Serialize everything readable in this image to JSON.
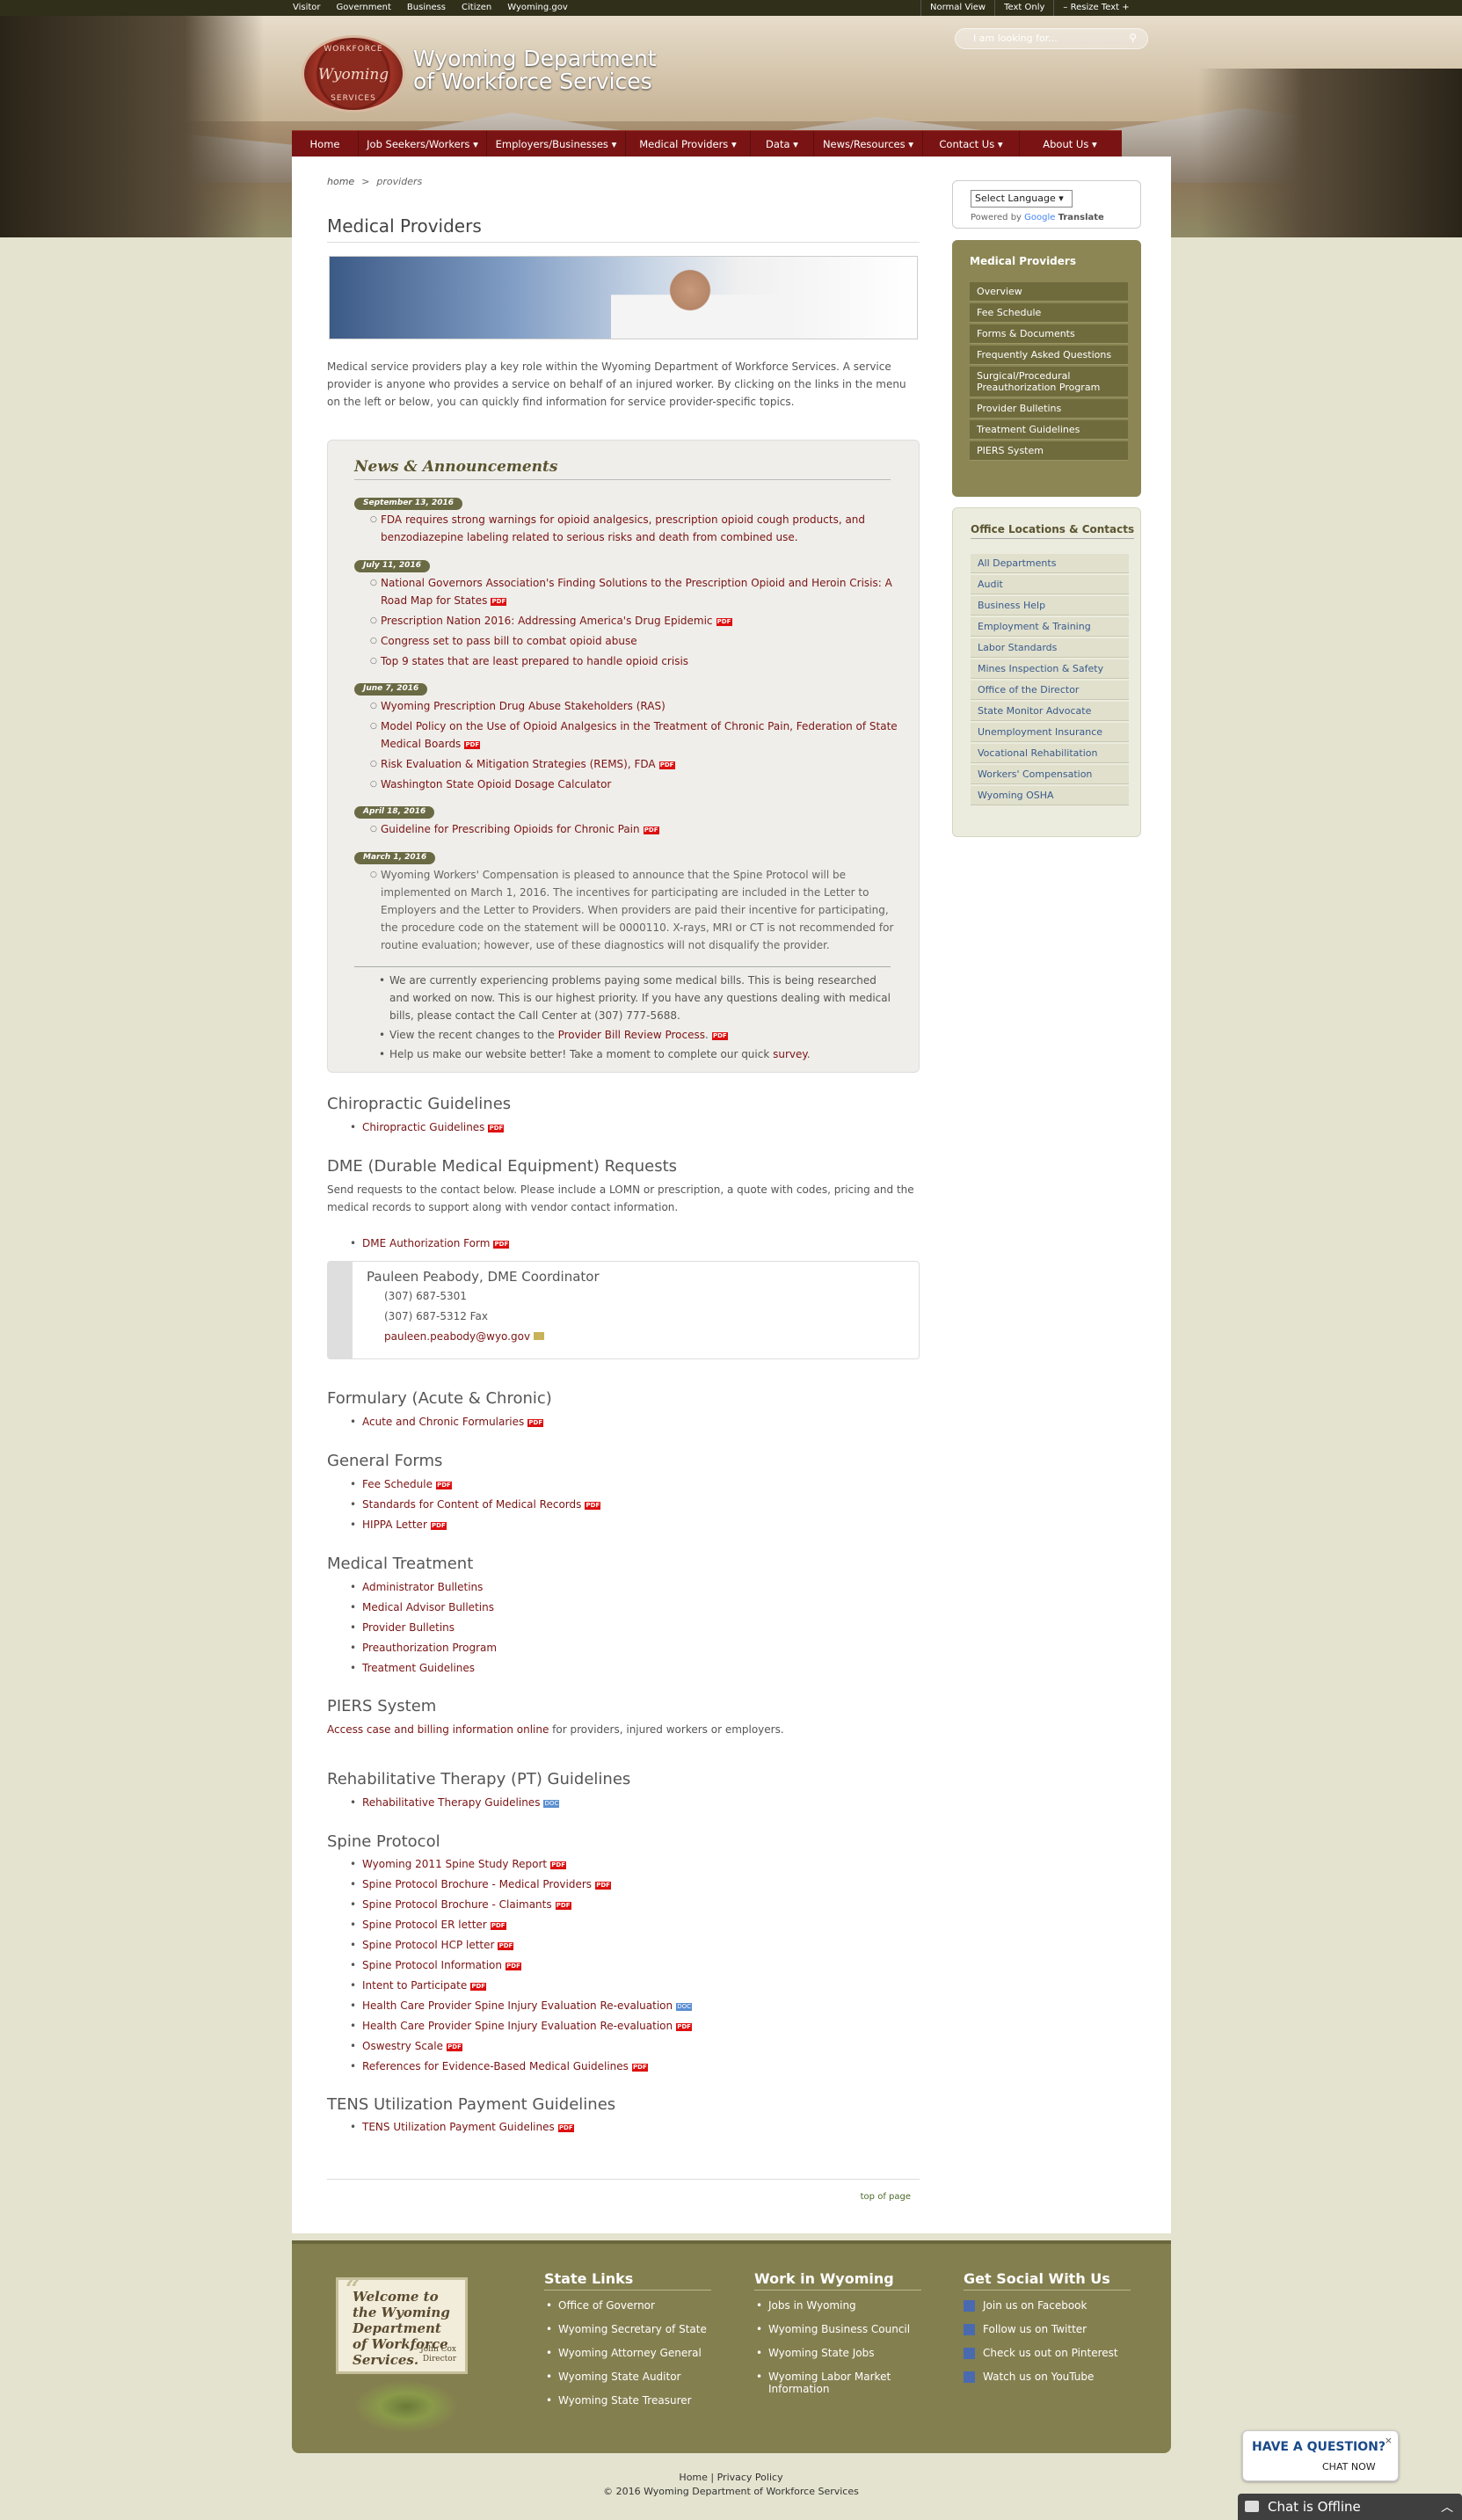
{
  "utility_nav": [
    "Visitor",
    "Government",
    "Business",
    "Citizen",
    "Wyoming.gov"
  ],
  "view_options": [
    "Normal View",
    "Text Only",
    "–  Resize Text  +"
  ],
  "logo": {
    "top": "WORKFORCE",
    "script": "Wyoming",
    "bottom": "SERVICES"
  },
  "site_title": [
    "Wyoming Department",
    "of Workforce Services"
  ],
  "search": {
    "placeholder": "I am looking for..."
  },
  "main_nav": [
    "Home",
    "Job Seekers/Workers ▾",
    "Employers/Businesses ▾",
    "Medical Providers ▾",
    "Data ▾",
    "News/Resources ▾",
    "Contact Us ▾",
    "About Us ▾"
  ],
  "breadcrumb": {
    "home": "home",
    "sep": ">",
    "current": "providers"
  },
  "page_title": "Medical Providers",
  "intro": "Medical service providers play a key role within the Wyoming Department of Workforce Services. A service provider is anyone who provides a service on behalf of an injured worker. By clicking on the links in the menu on the left or below, you can quickly find information for service provider-specific topics.",
  "news": {
    "title": "News & Announcements",
    "groups": [
      {
        "date": "September 13, 2016",
        "items": [
          "FDA requires strong warnings for opioid analgesics, prescription opioid cough products, and benzodiazepine labeling related to serious risks and death from combined use."
        ]
      },
      {
        "date": "July 11, 2016",
        "items": [
          "National Governors Association's Finding Solutions to the Prescription Opioid and Heroin Crisis: A Road Map for States",
          "Prescription Nation 2016: Addressing America's Drug Epidemic",
          "Congress set to pass bill to combat opioid abuse",
          "Top 9 states that are least prepared to handle opioid crisis"
        ]
      },
      {
        "date": "June 7, 2016",
        "items": [
          "Wyoming Prescription Drug Abuse Stakeholders (RAS)",
          "Model Policy on the Use of Opioid Analgesics in the Treatment of Chronic Pain, Federation of State Medical Boards",
          "Risk Evaluation & Mitigation Strategies (REMS), FDA",
          "Washington State Opioid Dosage Calculator"
        ]
      },
      {
        "date": "April 18, 2016",
        "items": [
          "Guideline for Prescribing Opioids for Chronic Pain"
        ]
      },
      {
        "date": "March 1, 2016",
        "items": [
          "Wyoming Workers' Compensation is pleased to announce that the Spine Protocol will be implemented on March 1, 2016. The incentives for participating are included in the Letter to Employers and the Letter to Providers. When providers are paid their incentive for participating, the procedure code on the statement will be 0000110. X-rays, MRI or CT is not recommended for routine evaluation; however, use of these diagnostics will not disqualify the provider."
        ]
      }
    ],
    "notes": [
      "We are currently experiencing problems paying some medical bills. This is being researched and worked on now. This is our highest priority. If you have any questions dealing with medical bills, please contact the Call Center at (307) 777-5688.",
      {
        "pre": "View the recent changes to the ",
        "link": "Provider Bill Review Process",
        "post": "."
      },
      {
        "pre": "Help us make our website better! Take a moment to complete our quick ",
        "link": "survey",
        "post": "."
      }
    ]
  },
  "sections": {
    "chiro": {
      "title": "Chiropractic Guidelines",
      "links": [
        "Chiropractic Guidelines"
      ]
    },
    "dme": {
      "title": "DME (Durable Medical Equipment) Requests",
      "text": "Send requests to the contact below. Please include a LOMN or prescription, a quote with codes, pricing and the medical records to support along with vendor contact information.",
      "links": [
        "DME Authorization Form"
      ],
      "contact": {
        "name": "Pauleen Peabody, DME Coordinator",
        "phone": "(307) 687-5301",
        "fax": "(307) 687-5312 Fax",
        "email": "pauleen.peabody@wyo.gov"
      }
    },
    "formulary": {
      "title": "Formulary (Acute & Chronic)",
      "links": [
        "Acute and Chronic Formularies"
      ]
    },
    "forms": {
      "title": "General Forms",
      "links": [
        "Fee Schedule",
        "Standards for Content of Medical Records",
        "HIPPA Letter"
      ]
    },
    "treatment": {
      "title": "Medical Treatment",
      "links": [
        "Administrator Bulletins",
        "Medical Advisor Bulletins",
        "Provider Bulletins",
        "Preauthorization Program",
        "Treatment Guidelines"
      ]
    },
    "piers": {
      "title": "PIERS System",
      "link": "Access case and billing information online",
      "text": " for providers, injured workers or employers."
    },
    "rehab": {
      "title": "Rehabilitative Therapy (PT) Guidelines",
      "links": [
        "Rehabilitative Therapy Guidelines"
      ]
    },
    "spine": {
      "title": "Spine Protocol",
      "links": [
        "Wyoming 2011 Spine Study Report",
        "Spine Protocol Brochure - Medical Providers",
        "Spine Protocol Brochure - Claimants",
        "Spine Protocol ER letter",
        "Spine Protocol HCP letter",
        "Spine Protocol Information",
        "Intent to Participate",
        "Health Care Provider Spine Injury Evaluation Re-evaluation",
        "Health Care Provider Spine Injury Evaluation Re-evaluation",
        "Oswestry Scale",
        "References for Evidence-Based Medical Guidelines"
      ]
    },
    "tens": {
      "title": "TENS Utilization Payment Guidelines",
      "links": [
        "TENS Utilization Payment Guidelines"
      ]
    }
  },
  "pdf_label": "PDF",
  "doc_label": "DOC",
  "top_of_page": "top of page",
  "language": {
    "select": "Select Language  ▾",
    "powered": "Powered by",
    "google": "Google",
    "translate": "Translate"
  },
  "sidebar_mp": {
    "title": "Medical Providers",
    "items": [
      "Overview",
      "Fee Schedule",
      "Forms & Documents",
      "Frequently Asked Questions",
      "Surgical/Procedural Preauthorization Program",
      "Provider Bulletins",
      "Treatment Guidelines",
      "PIERS System"
    ]
  },
  "sidebar_ol": {
    "title": "Office Locations & Contacts",
    "items": [
      "All Departments",
      "Audit",
      "Business Help",
      "Employment & Training",
      "Labor Standards",
      "Mines Inspection & Safety",
      "Office of the Director",
      "State Monitor Advocate",
      "Unemployment Insurance",
      "Vocational Rehabilitation",
      "Workers' Compensation",
      "Wyoming OSHA"
    ]
  },
  "footer": {
    "welcome": "Welcome to the Wyoming Department of Workforce Services.",
    "by": [
      "– John Cox",
      "Director"
    ],
    "state_links": {
      "title": "State Links",
      "items": [
        "Office of Governor",
        "Wyoming Secretary of State",
        "Wyoming Attorney General",
        "Wyoming State Auditor",
        "Wyoming State Treasurer"
      ]
    },
    "work": {
      "title": "Work in Wyoming",
      "items": [
        "Jobs in Wyoming",
        "Wyoming Business Council",
        "Wyoming State Jobs",
        "Wyoming Labor Market Information"
      ]
    },
    "social": {
      "title": "Get Social With Us",
      "items": [
        "Join us on Facebook",
        "Follow us on Twitter",
        "Check us out on Pinterest",
        "Watch us on YouTube"
      ]
    }
  },
  "copyright": {
    "home": "Home",
    "privacy": "Privacy Policy",
    "text": "© 2016 Wyoming Department of Workforce Services"
  },
  "chat": {
    "question": "HAVE A QUESTION?",
    "chat_now": "CHAT NOW",
    "close": "×",
    "status": "Chat is Offline"
  }
}
